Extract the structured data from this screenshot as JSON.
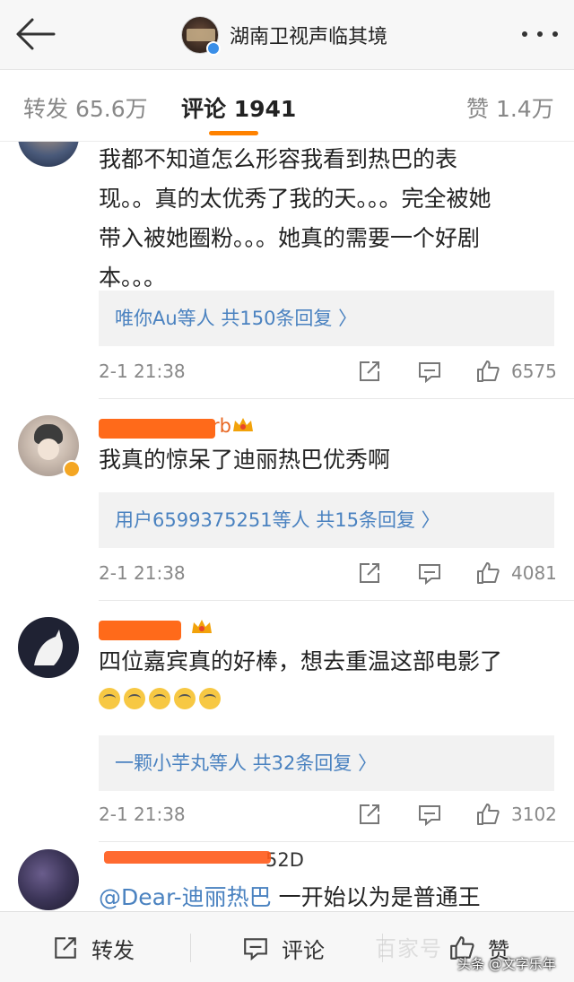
{
  "header": {
    "title": "湖南卫视声临其境",
    "back_icon": "arrow-left-icon",
    "more_icon": "more-dots-icon"
  },
  "tabs": {
    "repost_label": "转发 65.6万",
    "comment_label": "评论 1941",
    "like_label": "赞 1.4万",
    "accent": "#ff8200"
  },
  "comments": [
    {
      "name": "",
      "text_lines": [
        "我都不知道怎么形容我看到热巴的表",
        "现。。真的太优秀了我的天。。。完全被她",
        "带入被她圈粉。。。她真的需要一个好剧",
        "本。。。"
      ],
      "reply_summary": "唯你Au等人  共150条回复 〉",
      "time": "2-1 21:38",
      "likes": "6575"
    },
    {
      "name": "",
      "name_tail": "rb",
      "text_lines": [
        "我真的惊呆了迪丽热巴优秀啊"
      ],
      "reply_summary": "用户6599375251等人  共15条回复 〉",
      "time": "2-1 21:38",
      "likes": "4081"
    },
    {
      "name": "",
      "text_lines": [
        "四位嘉宾真的好棒，想去重温这部电影了"
      ],
      "reply_summary": "一颗小芋丸等人  共32条回复 〉",
      "time": "2-1 21:38",
      "likes": "3102"
    },
    {
      "name": "",
      "name_tail": "52D",
      "mention": "@Dear-迪丽热巴",
      "text_after_mention": " 一开始以为是普通王"
    }
  ],
  "bottom_bar": {
    "repost": "转发",
    "comment": "评论",
    "like": "赞"
  },
  "watermark": {
    "faint": "百家号",
    "credit": "头条 @文字乐年"
  }
}
